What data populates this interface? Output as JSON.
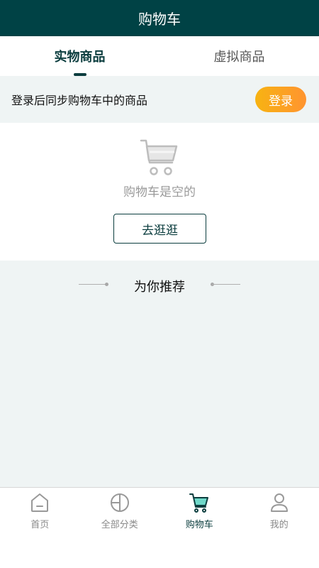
{
  "header": {
    "title": "购物车"
  },
  "tabs": [
    {
      "label": "实物商品",
      "active": true
    },
    {
      "label": "虚拟商品",
      "active": false
    }
  ],
  "login_bar": {
    "message": "登录后同步购物车中的商品",
    "button_label": "登录"
  },
  "empty_cart": {
    "message": "购物车是空的",
    "button_label": "去逛逛"
  },
  "recommend": {
    "title": "为你推荐"
  },
  "bottom_nav": {
    "items": [
      {
        "label": "首页",
        "icon": "home-icon",
        "active": false
      },
      {
        "label": "全部分类",
        "icon": "category-icon",
        "active": false
      },
      {
        "label": "购物车",
        "icon": "cart-icon",
        "active": true
      },
      {
        "label": "我的",
        "icon": "user-icon",
        "active": false
      }
    ]
  },
  "colors": {
    "header_bg": "#004245",
    "accent": "#0b3d3e",
    "login_gradient_start": "#f7b312",
    "login_gradient_end": "#ff9430",
    "cart_fill_active": "#6fd8c9"
  }
}
